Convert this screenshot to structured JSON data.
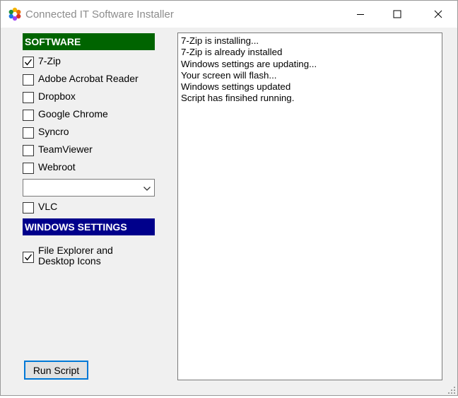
{
  "window": {
    "title": "Connected IT Software Installer"
  },
  "software": {
    "header": "SOFTWARE",
    "items": [
      {
        "label": "7-Zip",
        "checked": true
      },
      {
        "label": "Adobe Acrobat Reader",
        "checked": false
      },
      {
        "label": "Dropbox",
        "checked": false
      },
      {
        "label": "Google Chrome",
        "checked": false
      },
      {
        "label": "Syncro",
        "checked": false
      },
      {
        "label": "TeamViewer",
        "checked": false
      },
      {
        "label": "Webroot",
        "checked": false
      }
    ],
    "dropdown_value": "",
    "vlc": {
      "label": "VLC",
      "checked": false
    }
  },
  "windows_settings": {
    "header": "WINDOWS SETTINGS",
    "file_explorer": {
      "label": "File Explorer and Desktop Icons",
      "checked": true
    }
  },
  "log": {
    "lines": [
      "7-Zip is installing...",
      "7-Zip is already installed",
      "Windows settings are updating...",
      "Your screen will flash...",
      "Windows settings updated",
      "Script has finsihed running."
    ]
  },
  "run_button": {
    "label": "Run Script"
  },
  "colors": {
    "software_header_bg": "#006400",
    "windows_header_bg": "#00008b",
    "button_focus_border": "#0078d7"
  }
}
